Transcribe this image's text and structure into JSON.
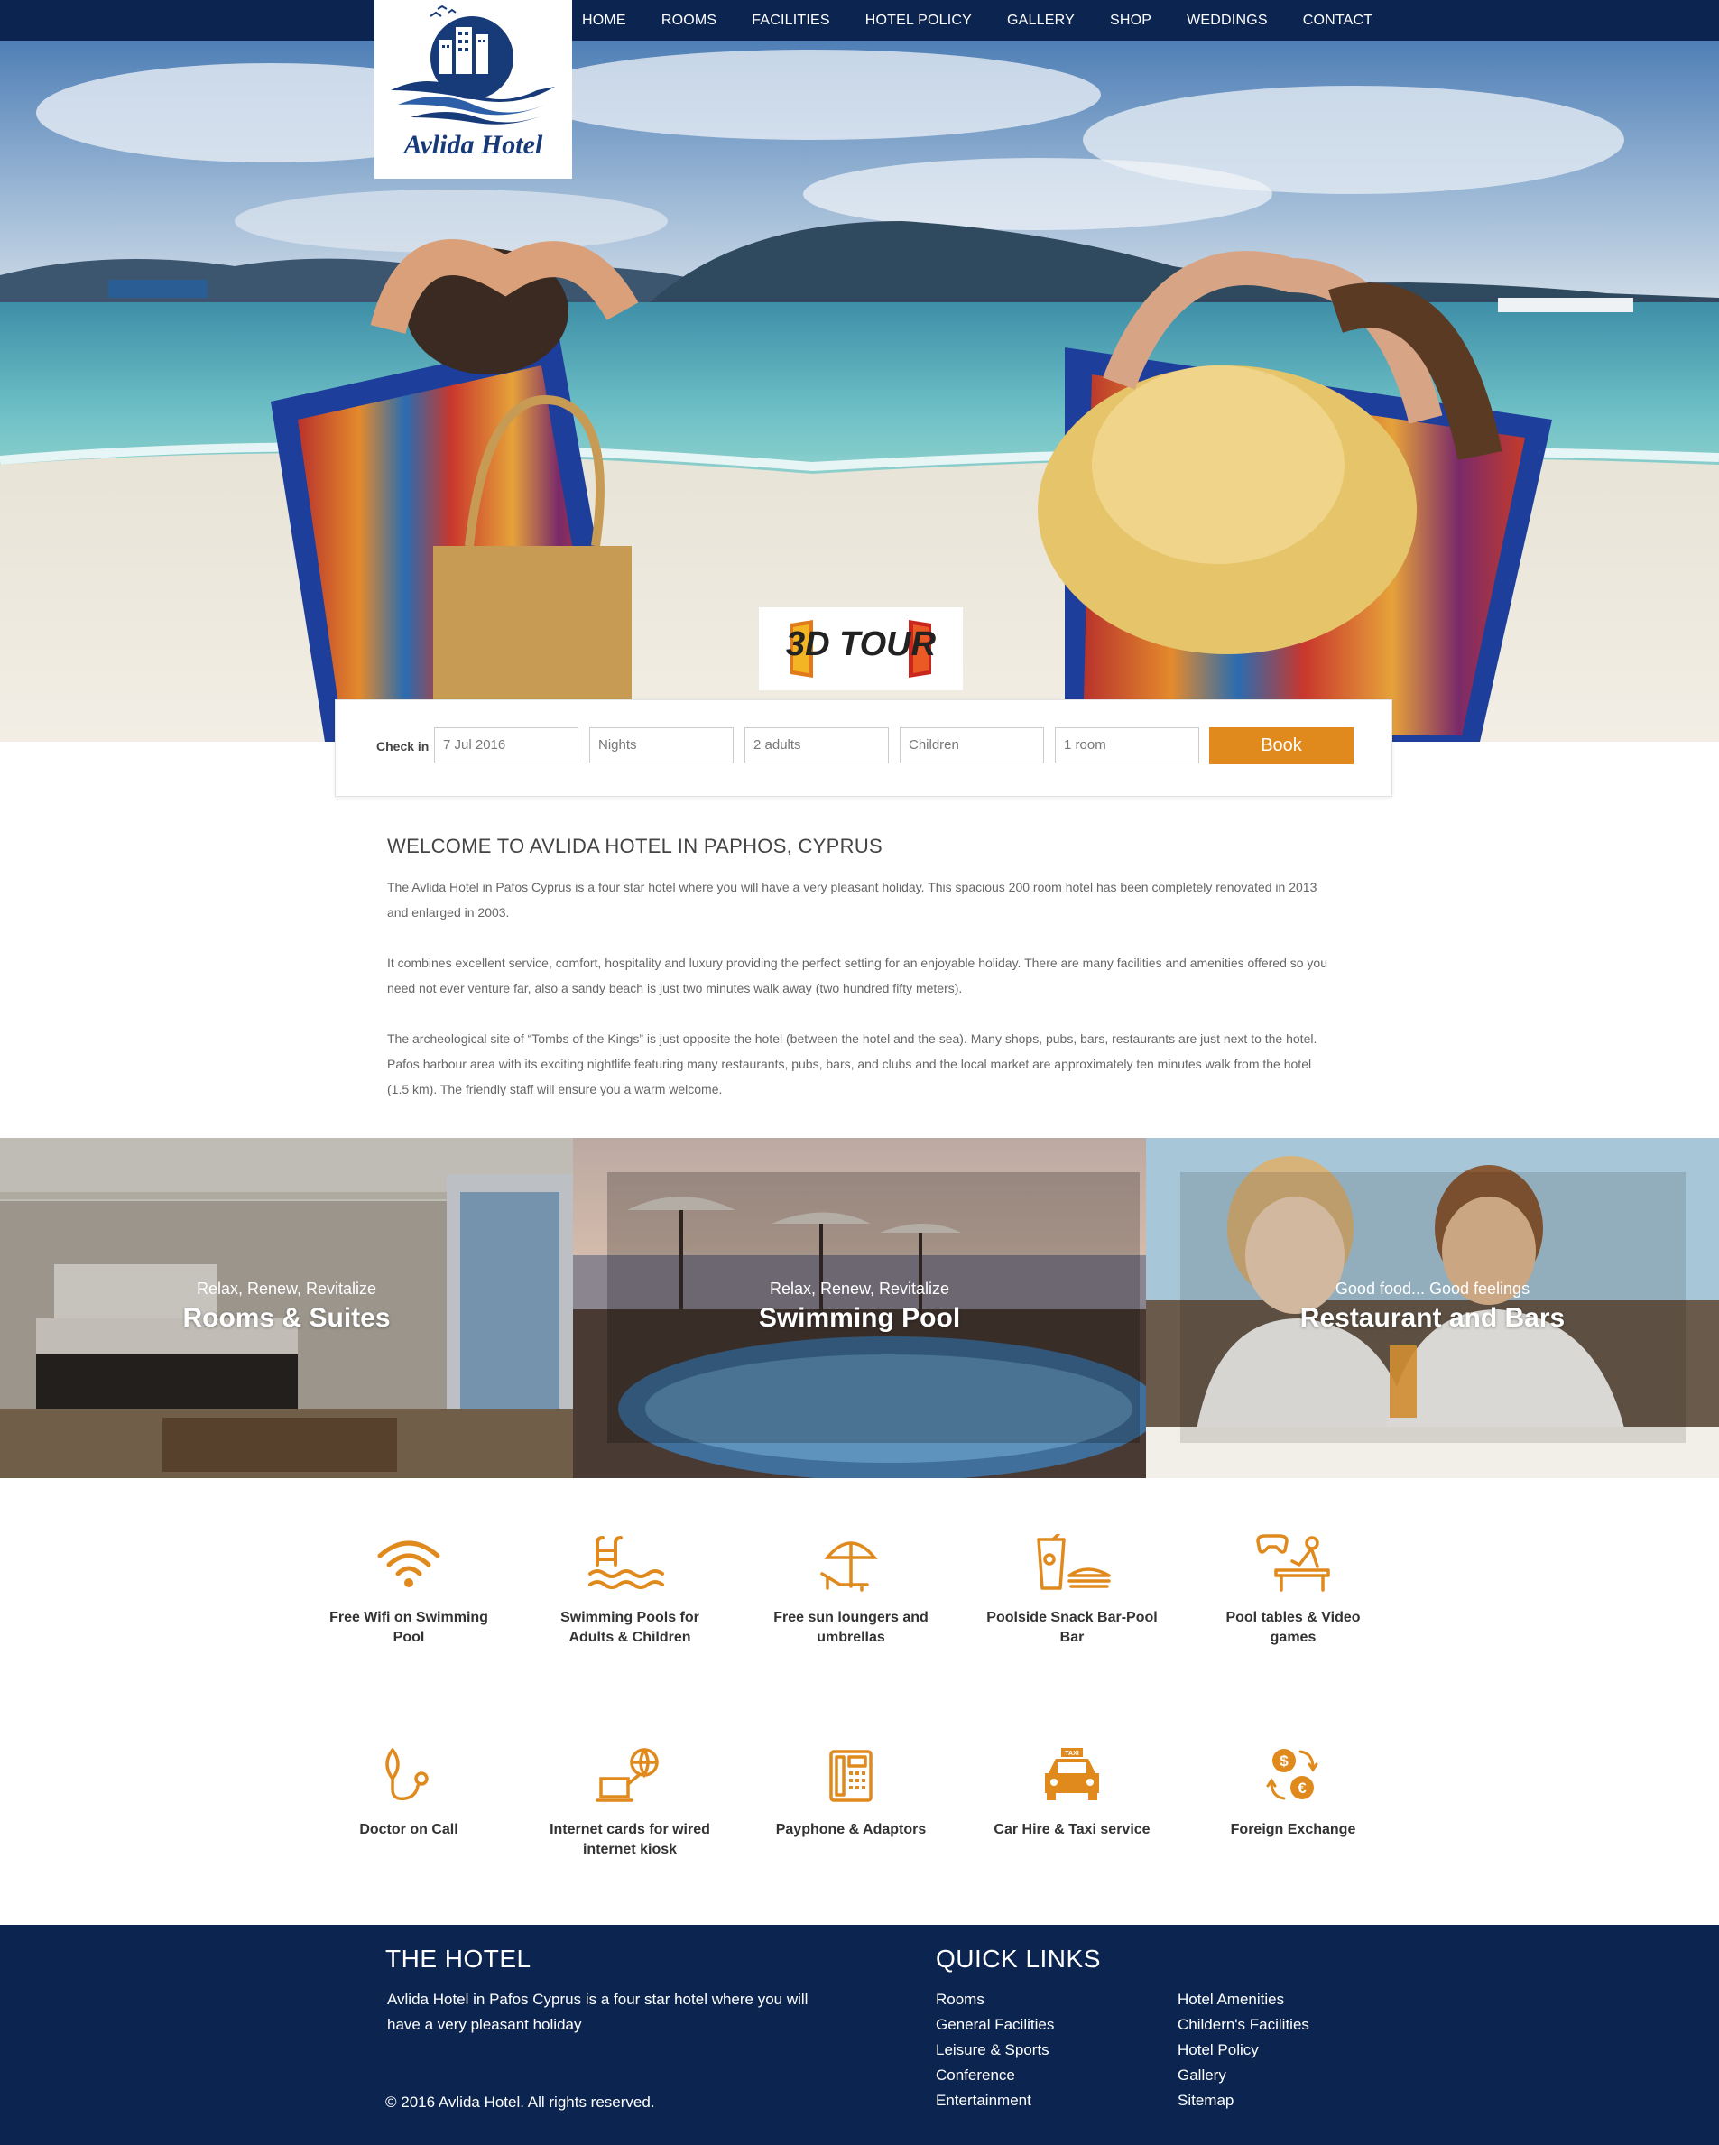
{
  "brand": {
    "name": "Avlida Hotel"
  },
  "nav": [
    "HOME",
    "ROOMS",
    "FACILITIES",
    "HOTEL POLICY",
    "GALLERY",
    "SHOP",
    "WEDDINGS",
    "CONTACT"
  ],
  "hero": {
    "tour_badge": "3D TOUR"
  },
  "booking": {
    "label": "Check in",
    "checkin_value": "7 Jul 2016",
    "nights_placeholder": "Nights",
    "adults_value": "2 adults",
    "children_placeholder": "Children",
    "rooms_value": "1 room",
    "button": "Book"
  },
  "welcome": {
    "title": "WELCOME TO AVLIDA HOTEL IN PAPHOS, CYPRUS",
    "paragraphs": [
      " The Avlida Hotel in Pafos Cyprus is a four star hotel where you will have a very pleasant holiday. This spacious 200 room hotel has been completely renovated in 2013 and enlarged in 2003.",
      "It combines excellent service, comfort, hospitality and luxury providing the perfect setting for an enjoyable holiday. There are many facilities and amenities offered so you need not ever venture far, also a sandy beach is just two minutes walk away (two hundred fifty meters).",
      "The archeological site of “Tombs of the Kings” is just opposite the hotel (between the hotel and the sea). Many shops, pubs, bars, restaurants are just next to the hotel. Pafos harbour area with its exciting nightlife featuring many restaurants, pubs, bars, and clubs and the local market are approximately ten minutes walk from the hotel (1.5 km). The friendly staff will ensure you a warm welcome."
    ]
  },
  "panels": [
    {
      "subtitle": "Relax, Renew, Revitalize",
      "title": "Rooms & Suites"
    },
    {
      "subtitle": "Relax, Renew, Revitalize",
      "title": "Swimming Pool"
    },
    {
      "subtitle": "Good food... Good feelings",
      "title": "Restaurant and Bars"
    }
  ],
  "amenities": [
    {
      "icon": "wifi-icon",
      "label": "Free Wifi on Swimming Pool"
    },
    {
      "icon": "pool-icon",
      "label": "Swimming Pools for Adults & Children"
    },
    {
      "icon": "umbrella-icon",
      "label": "Free sun loungers and umbrellas"
    },
    {
      "icon": "snack-bar-icon",
      "label": "Poolside Snack Bar-Pool Bar"
    },
    {
      "icon": "games-icon",
      "label": "Pool tables & Video games"
    },
    {
      "icon": "stethoscope-icon",
      "label": "Doctor on Call"
    },
    {
      "icon": "internet-kiosk-icon",
      "label": "Internet cards for wired internet kiosk"
    },
    {
      "icon": "payphone-icon",
      "label": "Payphone & Adaptors"
    },
    {
      "icon": "taxi-icon",
      "label": "Car Hire & Taxi service",
      "badge": "TAXI"
    },
    {
      "icon": "currency-exchange-icon",
      "label": "Foreign Exchange"
    }
  ],
  "footer": {
    "hotel_title": "THE HOTEL",
    "hotel_text": "Avlida Hotel in Pafos Cyprus is a four star hotel where you will have a very pleasant holiday",
    "copyright": "© 2016 Avlida Hotel. All rights reserved.",
    "links_title": "QUICK LINKS",
    "links_col1": [
      "Rooms",
      "General Facilities",
      "Leisure & Sports",
      "Conference",
      "Entertainment"
    ],
    "links_col2": [
      "Hotel Amenities",
      "Childern's Facilities",
      "Hotel Policy",
      "Gallery",
      "Sitemap"
    ]
  },
  "colors": {
    "navy": "#0c2550",
    "accent": "#e08a1e",
    "logo_blue": "#173a78"
  }
}
